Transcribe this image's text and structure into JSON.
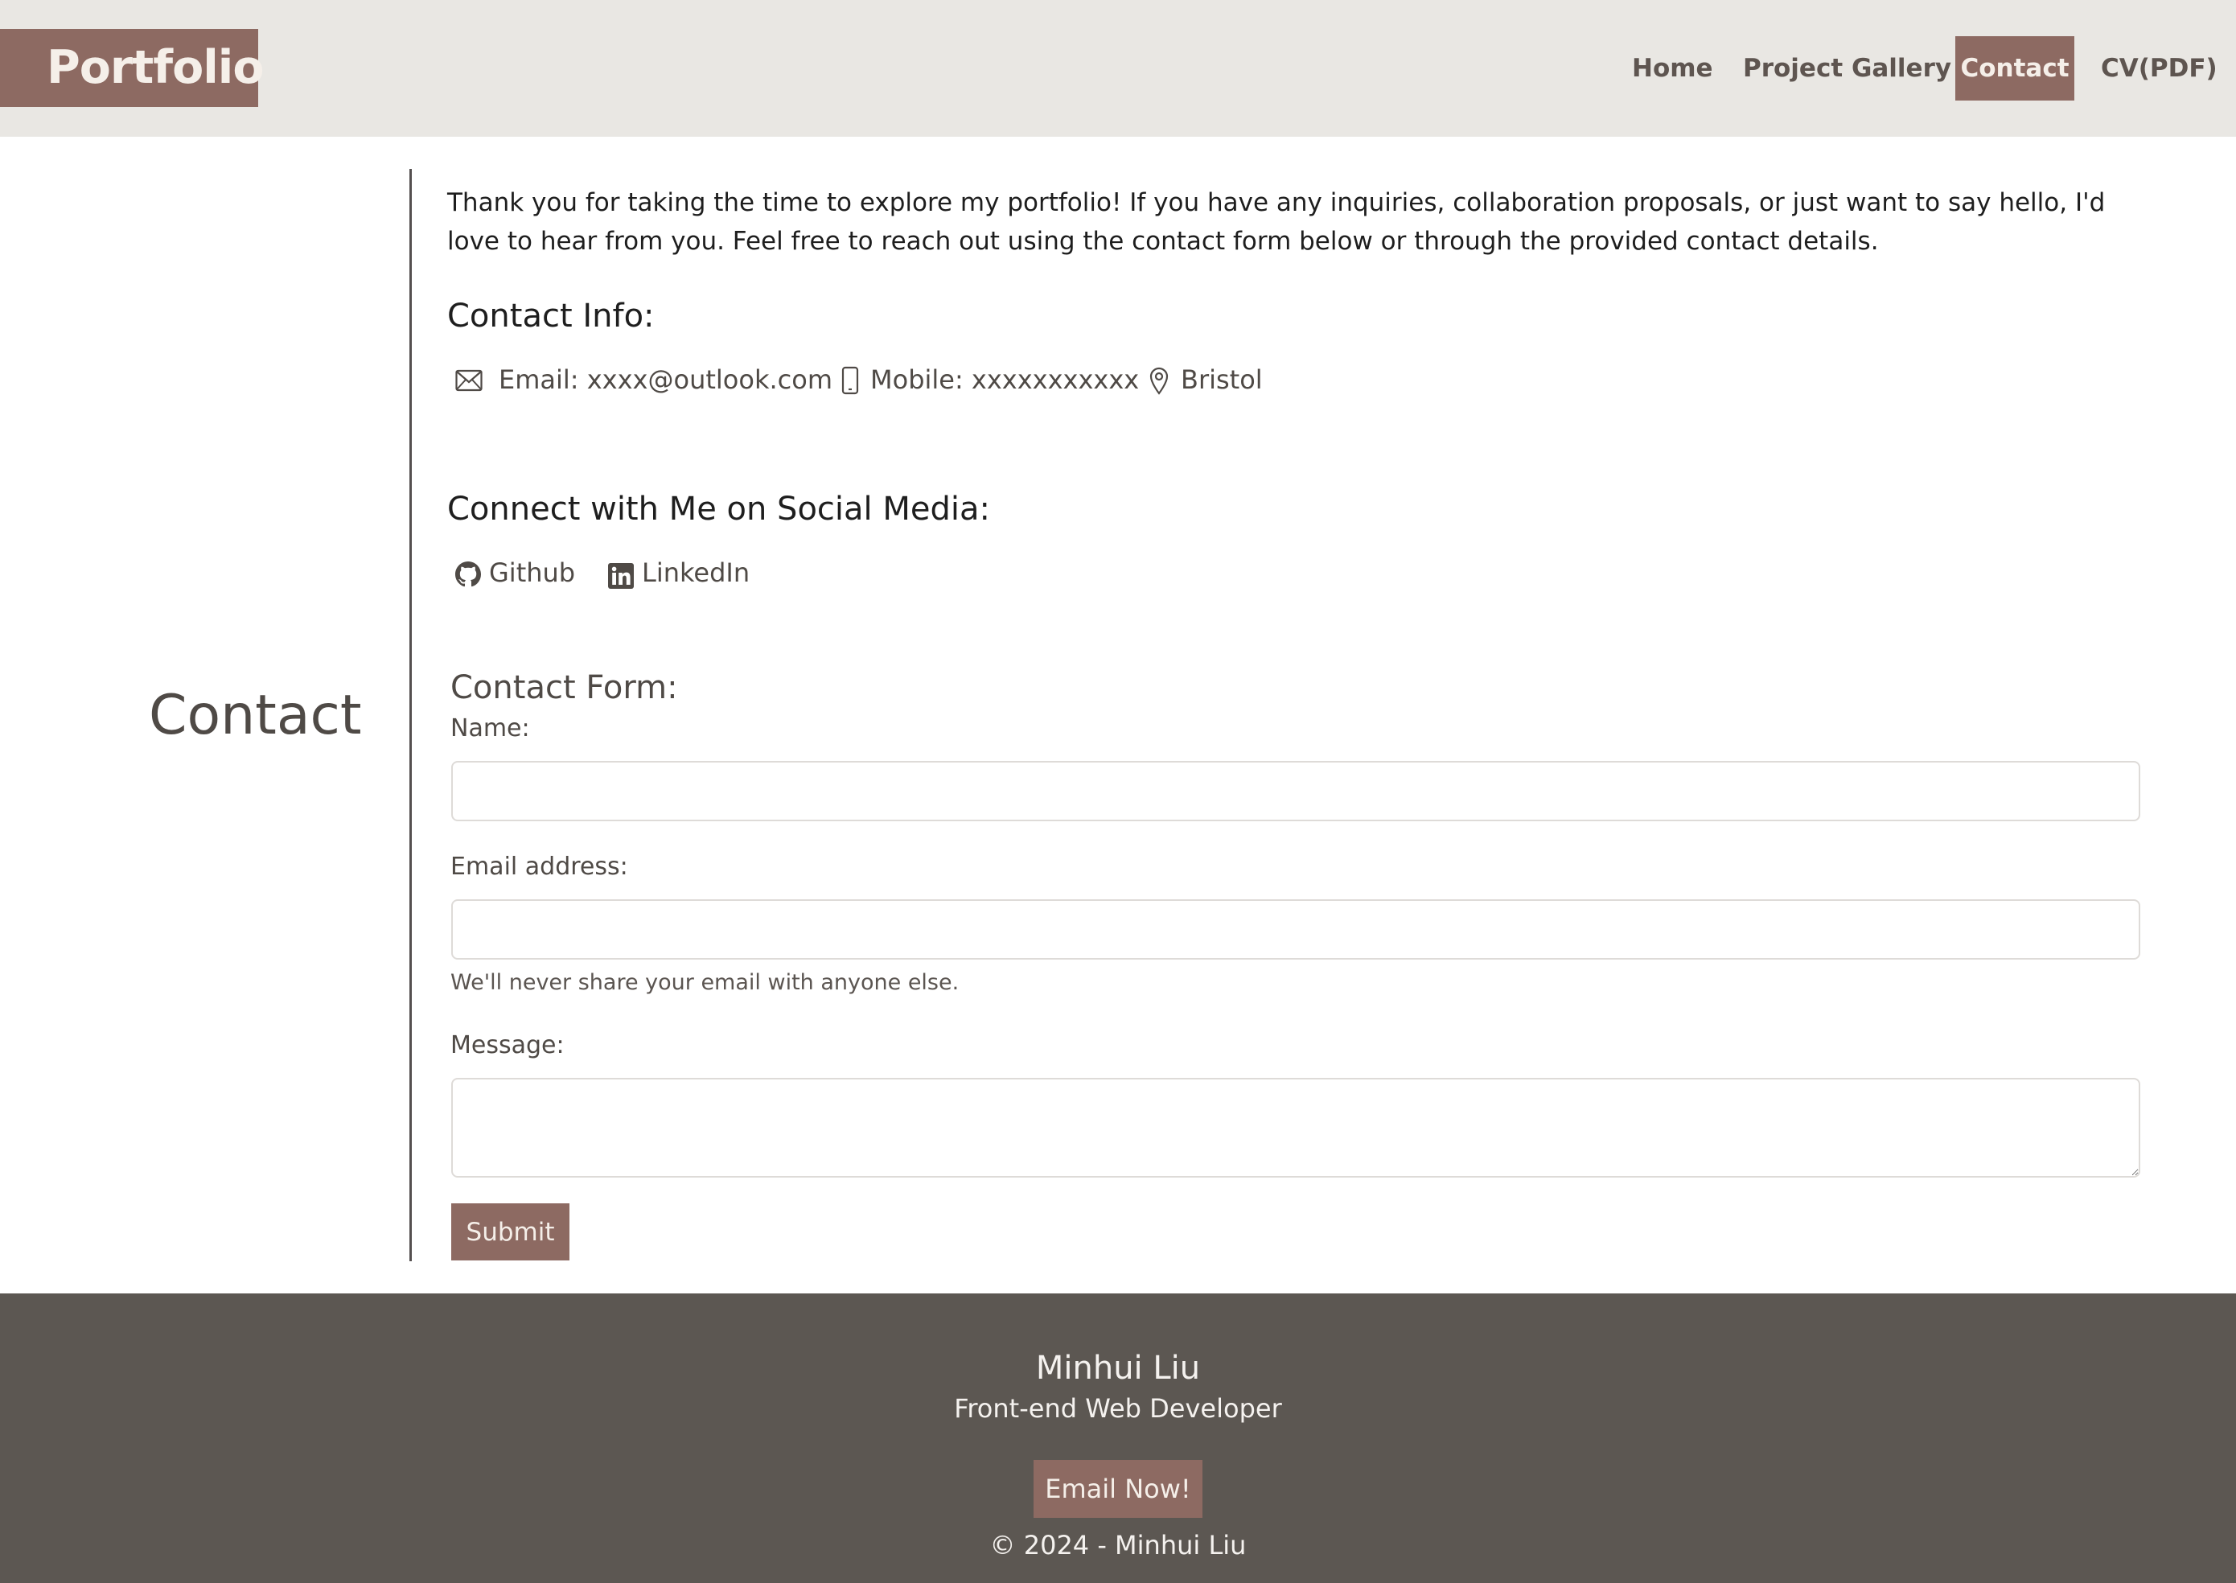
{
  "header": {
    "brand": "Portfolio",
    "nav": {
      "home": "Home",
      "gallery": "Project Gallery",
      "contact": "Contact",
      "cv": "CV(PDF)"
    }
  },
  "side_title": "Contact",
  "intro": "Thank you for taking the time to explore my portfolio! If you have any inquiries, collaboration proposals, or just want to say hello, I'd love to hear from you. Feel free to reach out using the contact form below or through the provided contact details.",
  "contact_info": {
    "heading": "Contact Info:",
    "email": "Email: xxxx@outlook.com",
    "mobile": "Mobile: xxxxxxxxxxx",
    "location": "Bristol"
  },
  "social": {
    "heading": "Connect with Me on Social Media:",
    "github": "Github",
    "linkedin": "LinkedIn"
  },
  "form": {
    "heading": "Contact Form:",
    "name_label": "Name:",
    "email_label": "Email address:",
    "email_help": "We'll never share your email with anyone else.",
    "message_label": "Message:",
    "submit": "Submit"
  },
  "footer": {
    "name": "Minhui Liu",
    "role": "Front-end Web Developer",
    "button": "Email Now!",
    "copyright": "© 2024 - Minhui Liu"
  },
  "colors": {
    "accent": "#8d6a62",
    "header_bg": "#e9e7e3",
    "footer_bg": "#5c5752"
  }
}
